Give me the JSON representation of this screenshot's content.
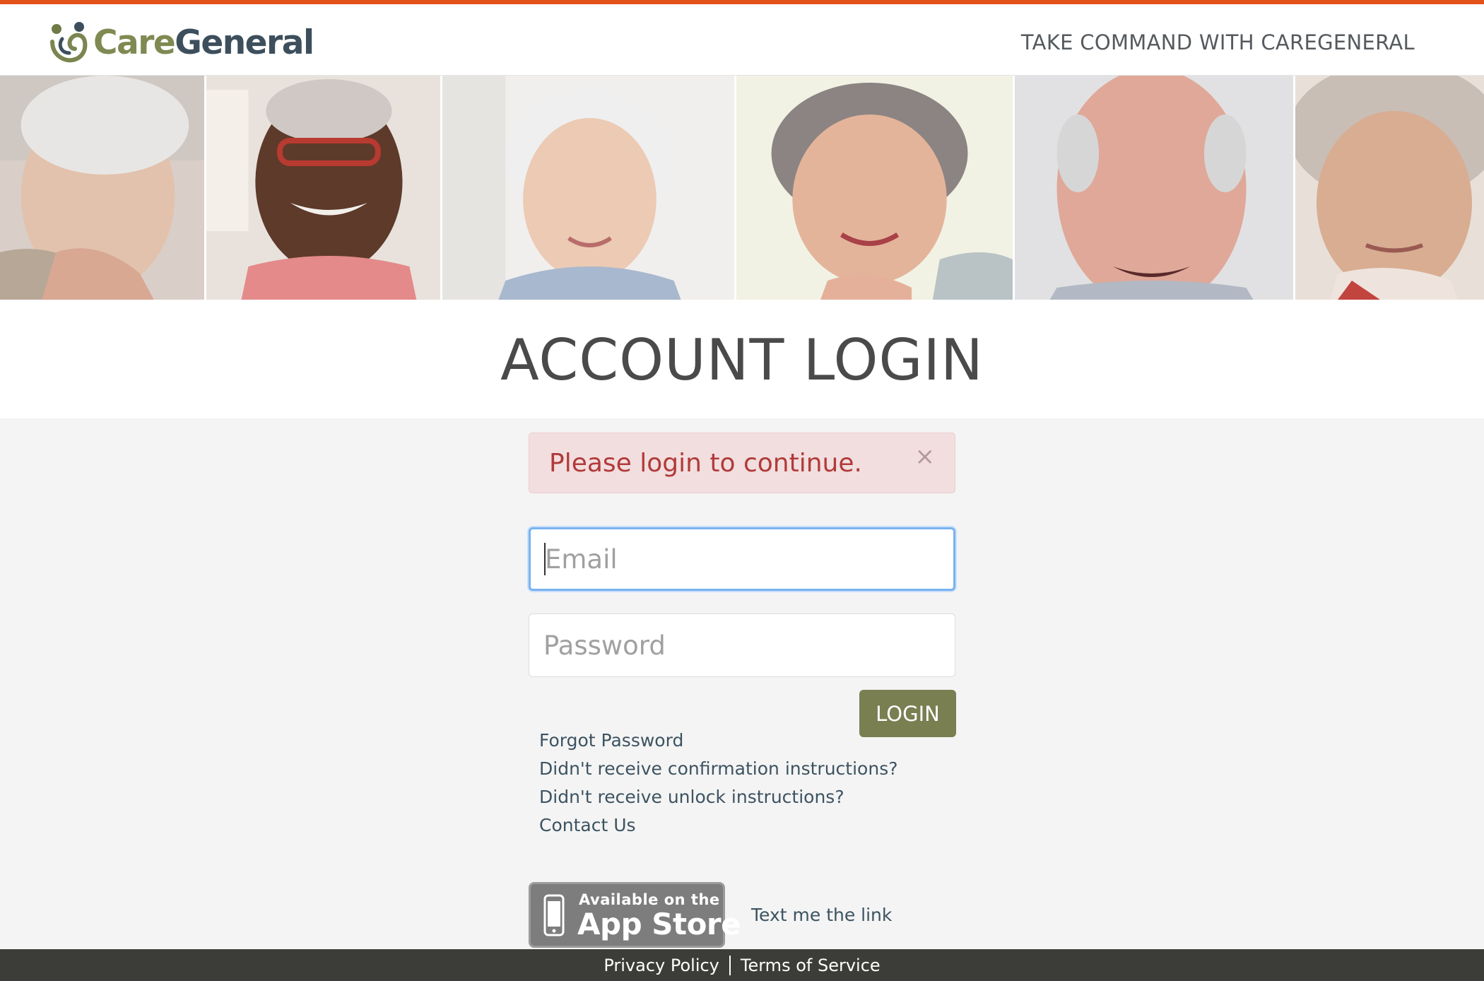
{
  "brand": {
    "name_part1": "Care",
    "name_part2": "General",
    "tagline": "TAKE COMMAND WITH CAREGENERAL",
    "accent_color": "#e2521a",
    "olive_color": "#7a7f52"
  },
  "hero_photos": [
    {
      "subject": "elderly-woman-smiling-hand-on-chin"
    },
    {
      "subject": "elderly-man-glasses-laughing"
    },
    {
      "subject": "elderly-woman-white-hair-smiling"
    },
    {
      "subject": "elderly-asian-woman-smiling"
    },
    {
      "subject": "elderly-man-bald-smiling"
    },
    {
      "subject": "elderly-woman-headscarf"
    }
  ],
  "page": {
    "title": "ACCOUNT LOGIN"
  },
  "alert": {
    "message": "Please login to continue.",
    "close_glyph": "×"
  },
  "form": {
    "email_placeholder": "Email",
    "password_placeholder": "Password",
    "login_label": "LOGIN"
  },
  "help_links": [
    "Forgot Password",
    "Didn't receive confirmation instructions?",
    "Didn't receive unlock instructions?",
    "Contact Us"
  ],
  "app_store": {
    "line1": "Available on the",
    "line2": "App Store",
    "icon": "phone-icon"
  },
  "text_link": "Text me the link",
  "footer": {
    "privacy": "Privacy Policy",
    "terms": "Terms of Service"
  }
}
